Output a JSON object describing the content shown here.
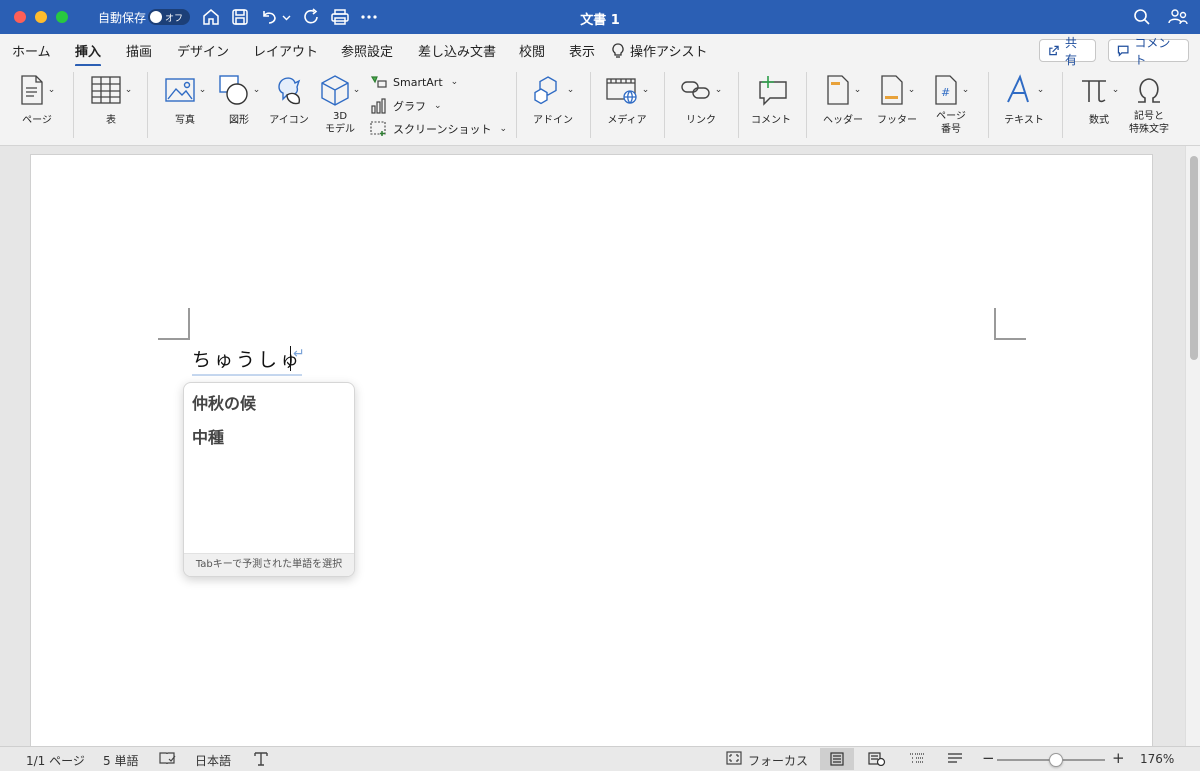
{
  "window": {
    "title": "文書 1",
    "autosave_label": "自動保存",
    "autosave_state": "オフ"
  },
  "tabs": [
    {
      "label": "ホーム"
    },
    {
      "label": "挿入"
    },
    {
      "label": "描画"
    },
    {
      "label": "デザイン"
    },
    {
      "label": "レイアウト"
    },
    {
      "label": "参照設定"
    },
    {
      "label": "差し込み文書"
    },
    {
      "label": "校閲"
    },
    {
      "label": "表示"
    },
    {
      "label": "操作アシスト"
    }
  ],
  "header_buttons": {
    "share": "共有",
    "comment": "コメント"
  },
  "ribbon": {
    "page": "ページ",
    "table": "表",
    "photo": "写真",
    "shapes": "図形",
    "icons": "アイコン",
    "model3d": "3D\nモデル",
    "smartart": "SmartArt",
    "graph": "グラフ",
    "screenshot": "スクリーンショット",
    "addin": "アドイン",
    "media": "メディア",
    "link": "リンク",
    "comment": "コメント",
    "header": "ヘッダー",
    "footer": "フッター",
    "page_number": "ページ\n番号",
    "text": "テキスト",
    "equation": "数式",
    "symbols": "記号と\n特殊文字"
  },
  "document": {
    "typed_text": "ちゅうしゅ"
  },
  "suggestions": {
    "items": [
      "仲秋の候",
      "中種"
    ],
    "footer": "Tabキーで予測された単語を選択"
  },
  "statusbar": {
    "page": "1/1 ページ",
    "words": "5 単語",
    "language": "日本語",
    "focus": "フォーカス",
    "zoom": "176%",
    "zoom_fraction": 0.55
  },
  "colors": {
    "accent": "#2b5fb4",
    "ribbon_bg": "#f3f3f3"
  }
}
